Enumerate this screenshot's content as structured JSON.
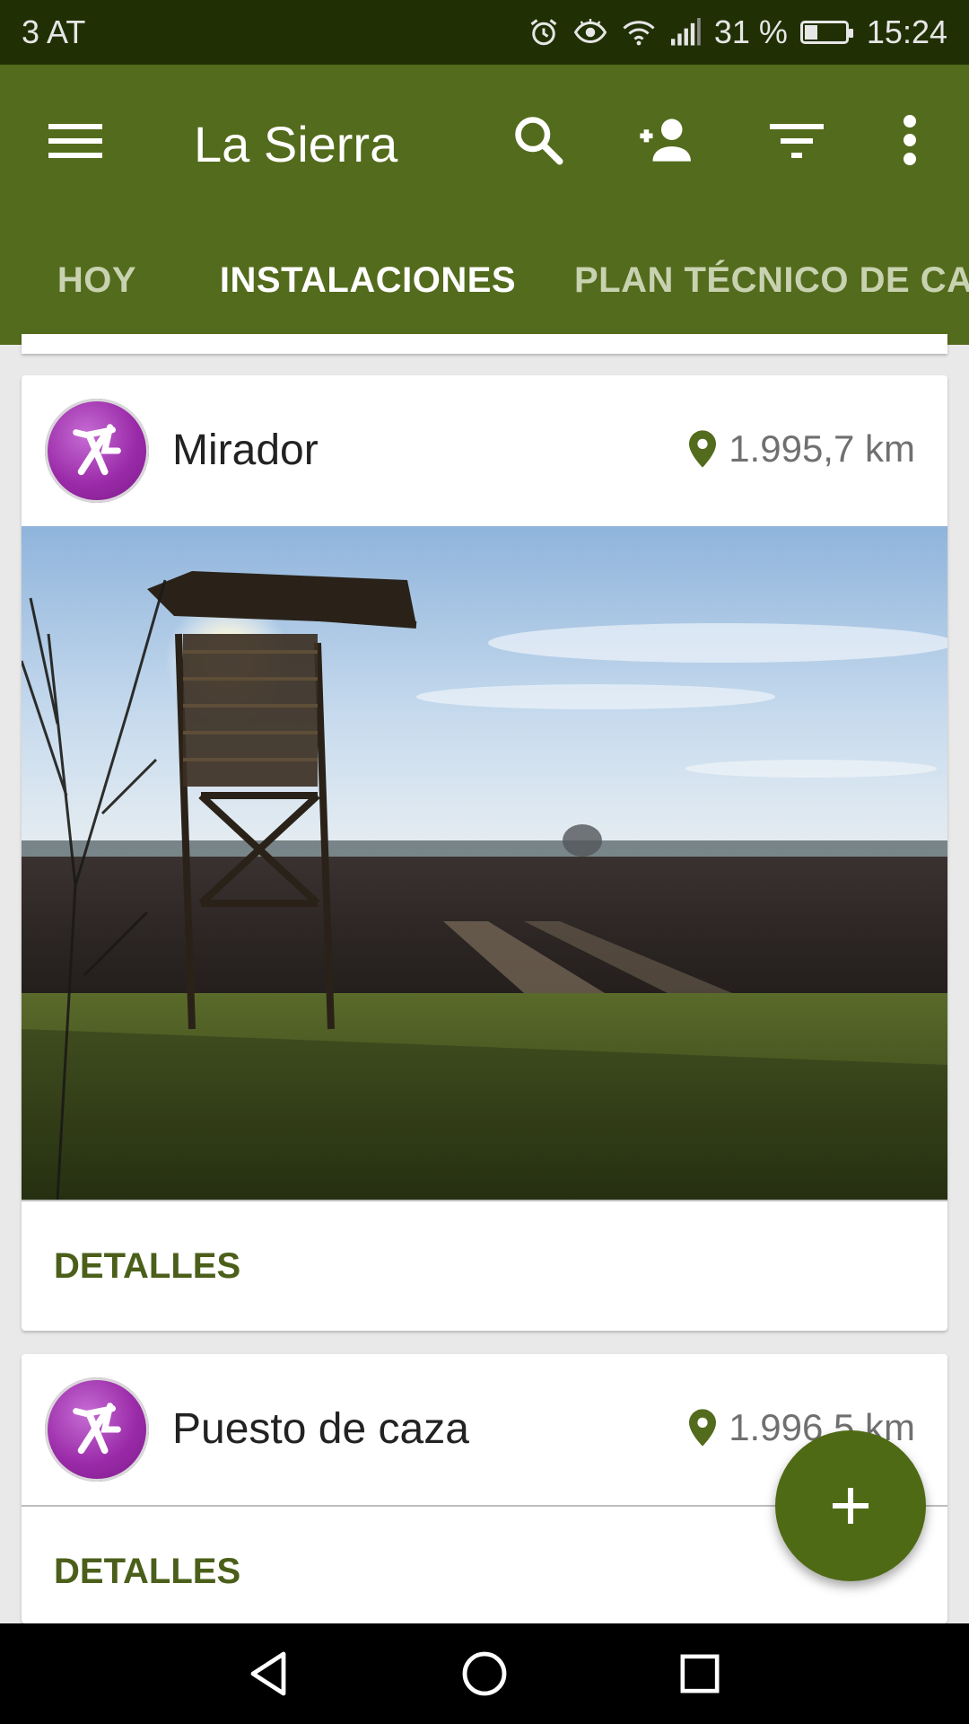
{
  "status_bar": {
    "carrier": "3 AT",
    "battery_percent": "31 %",
    "battery_level": 0.31,
    "time": "15:24",
    "icons": [
      "alarm-icon",
      "eye-icon",
      "wifi-icon",
      "signal-icon",
      "battery-icon"
    ]
  },
  "app_bar": {
    "title": "La Sierra",
    "actions": [
      "menu-icon",
      "search-icon",
      "add-person-icon",
      "filter-icon",
      "more-vert-icon"
    ]
  },
  "tabs": [
    {
      "label": "HOY",
      "active": false
    },
    {
      "label": "INSTALACIONES",
      "active": true
    },
    {
      "label": "PLAN TÉCNICO DE CAZA",
      "active": false
    }
  ],
  "cards": [
    {
      "title": "Mirador",
      "distance": "1.995,7 km",
      "icon": "hunting-stand-icon",
      "has_photo": true,
      "action_label": "DETALLES"
    },
    {
      "title": "Puesto de caza",
      "distance": "1.996,5 km",
      "icon": "hunting-stand-icon",
      "has_photo": false,
      "action_label": "DETALLES"
    }
  ],
  "fab": {
    "icon": "plus-icon"
  },
  "nav_bar": {
    "icons": [
      "back-icon",
      "home-icon",
      "recents-icon"
    ]
  },
  "colors": {
    "primary": "#536b1c",
    "status_bar": "#213004",
    "accent": "#4f6a14",
    "avatar": "#9a2aa8"
  }
}
